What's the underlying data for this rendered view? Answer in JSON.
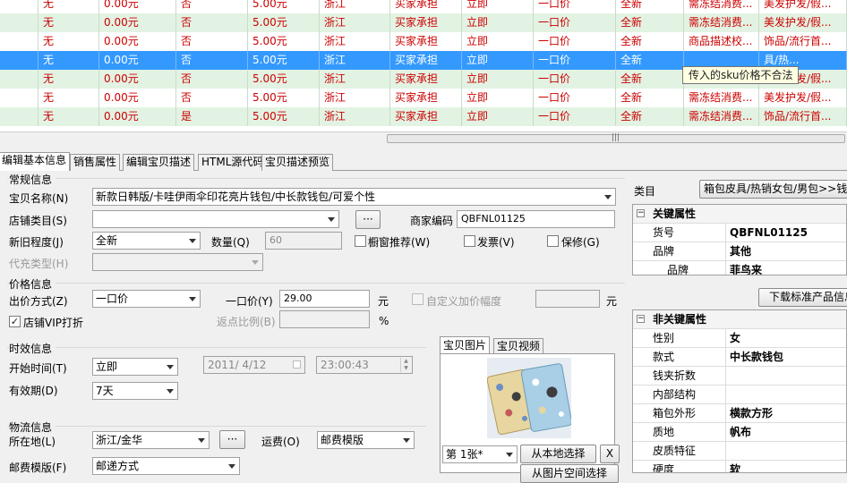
{
  "grid": {
    "rows": [
      {
        "style": "white",
        "cells": [
          "无",
          "0.00元",
          "否",
          "5.00元",
          "浙江",
          "买家承担",
          "立即",
          "一口价",
          "全新",
          "需冻结消费...",
          "美发护发/假..."
        ]
      },
      {
        "style": "green",
        "cells": [
          "无",
          "0.00元",
          "否",
          "5.00元",
          "浙江",
          "买家承担",
          "立即",
          "一口价",
          "全新",
          "需冻结消费...",
          "美发护发/假..."
        ]
      },
      {
        "style": "white",
        "cells": [
          "无",
          "0.00元",
          "否",
          "5.00元",
          "浙江",
          "买家承担",
          "立即",
          "一口价",
          "全新",
          "商品描述校...",
          "饰品/流行首..."
        ]
      },
      {
        "style": "sel",
        "cells": [
          "无",
          "0.00元",
          "否",
          "5.00元",
          "浙江",
          "买家承担",
          "立即",
          "一口价",
          "全新",
          "",
          "具/热..."
        ]
      },
      {
        "style": "green",
        "cells": [
          "无",
          "0.00元",
          "否",
          "5.00元",
          "浙江",
          "买家承担",
          "立即",
          "一口价",
          "全新",
          "需冻结消费...",
          "美发护发/假..."
        ]
      },
      {
        "style": "white",
        "cells": [
          "无",
          "0.00元",
          "否",
          "5.00元",
          "浙江",
          "买家承担",
          "立即",
          "一口价",
          "全新",
          "需冻结消费...",
          "美发护发/假..."
        ]
      },
      {
        "style": "green",
        "cells": [
          "无",
          "0.00元",
          "是",
          "5.00元",
          "浙江",
          "买家承担",
          "立即",
          "一口价",
          "全新",
          "需冻结消费...",
          "饰品/流行首..."
        ]
      }
    ],
    "tooltip": "传入的sku价格不合法",
    "scroll_grip": "|||"
  },
  "tabs": [
    "编辑基本信息",
    "销售属性",
    "编辑宝贝描述",
    "HTML源代码",
    "宝贝描述预览"
  ],
  "general": {
    "section": "常规信息",
    "title_label": "宝贝名称(N)",
    "title_value": "新款日韩版/卡哇伊雨伞印花亮片钱包/中长款钱包/可爱个性",
    "shop_cat_label": "店铺类目(S)",
    "shop_cat_value": "",
    "more_btn": "···",
    "sku_label": "商家编码",
    "sku_value": "QBFNL01125",
    "cond_label": "新旧程度(J)",
    "cond_value": "全新",
    "qty_label": "数量(Q)",
    "qty_value": "60",
    "window_rec": "橱窗推荐(W)",
    "invoice": "发票(V)",
    "warranty": "保修(G)",
    "proxy_label": "代充类型(H)",
    "proxy_value": ""
  },
  "price": {
    "section": "价格信息",
    "method_label": "出价方式(Z)",
    "method_value": "一口价",
    "fixed_label": "一口价(Y)",
    "fixed_value": "29.00",
    "unit": "元",
    "custom_label": "自定义加价幅度",
    "custom_unit": "元",
    "vip_label": "店铺VIP打折",
    "rebate_label": "返点比例(B)",
    "rebate_unit": "%"
  },
  "timing": {
    "section": "时效信息",
    "start_label": "开始时间(T)",
    "start_value": "立即",
    "date_value": "2011/ 4/12",
    "time_value": "23:00:43",
    "period_label": "有效期(D)",
    "period_value": "7天"
  },
  "media": {
    "tab_pic": "宝贝图片",
    "tab_video": "宝贝视频",
    "page_select": "第 1张*",
    "local_btn": "从本地选择",
    "close_btn": "X",
    "space_btn": "从图片空间选择"
  },
  "logistics": {
    "section": "物流信息",
    "loc_label": "所在地(L)",
    "loc_value": "浙江/金华",
    "more_btn": "···",
    "freight_label": "运费(O)",
    "freight_value": "邮费模版",
    "tpl_label": "邮费模版(F)",
    "tpl_value": "邮递方式"
  },
  "category": {
    "label": "类目",
    "value": "箱包皮具/热销女包/男包>>钱包"
  },
  "key_props": {
    "header": "关键属性",
    "rows": [
      [
        "货号",
        "QBFNL01125"
      ],
      [
        "品牌",
        "其他"
      ],
      [
        "品牌",
        "菲鸟来"
      ]
    ]
  },
  "download_btn": "下载标准产品信息",
  "nonkey_props": {
    "header": "非关键属性",
    "rows": [
      [
        "性别",
        "女"
      ],
      [
        "款式",
        "中长款钱包"
      ],
      [
        "钱夹折数",
        ""
      ],
      [
        "内部结构",
        ""
      ],
      [
        "箱包外形",
        "横款方形"
      ],
      [
        "质地",
        "帆布"
      ],
      [
        "皮质特征",
        ""
      ],
      [
        "硬度",
        "软"
      ]
    ]
  }
}
